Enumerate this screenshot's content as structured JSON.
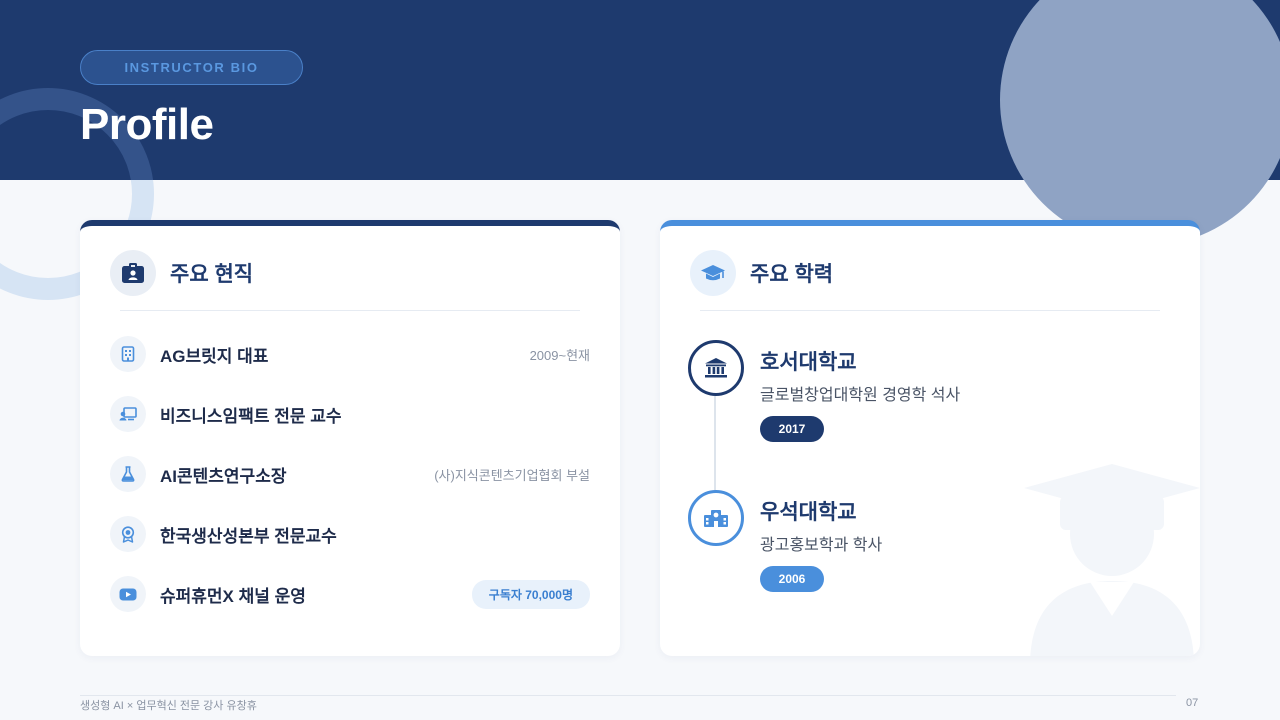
{
  "header": {
    "eyebrow": "INSTRUCTOR BIO",
    "title": "Profile"
  },
  "current_positions": {
    "heading": "주요 현직",
    "heading_icon": "id-badge-icon",
    "items": [
      {
        "label": "AG브릿지 대표",
        "note": "2009~현재",
        "icon": "building-icon"
      },
      {
        "label": "비즈니스임팩트 전문 교수",
        "note": "",
        "icon": "presentation-icon"
      },
      {
        "label": "AI콘텐츠연구소장",
        "note": "(사)지식콘텐츠기업협회 부설",
        "icon": "flask-icon"
      },
      {
        "label": "한국생산성본부 전문교수",
        "note": "",
        "icon": "award-icon"
      },
      {
        "label": "슈퍼휴먼X 채널 운영",
        "badge": "구독자 70,000명",
        "icon": "youtube-icon"
      }
    ]
  },
  "education": {
    "heading": "주요 학력",
    "heading_icon": "graduation-cap-icon",
    "items": [
      {
        "school": "호서대학교",
        "major": "글로벌창업대학원 경영학 석사",
        "year": "2017",
        "icon": "university-icon"
      },
      {
        "school": "우석대학교",
        "major": "광고홍보학과 학사",
        "year": "2006",
        "icon": "school-icon"
      }
    ]
  },
  "footer": {
    "text": "생성형 AI × 업무혁신 전문 강사 유창휴",
    "page": "07"
  },
  "colors": {
    "navy": "#1e3a6e",
    "accent_blue": "#4a8fdc",
    "background": "#f6f8fb"
  }
}
